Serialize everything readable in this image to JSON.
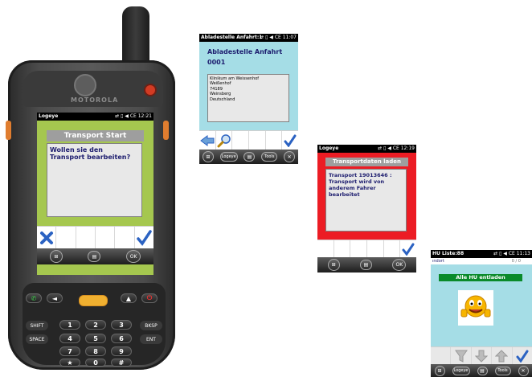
{
  "screen1": {
    "status_title": "Logeye",
    "status_icons": "⇄ ▯ ◀ CE 12:21",
    "panel_title": "Transport Start",
    "message": "Wollen sie den Transport bearbeiten?",
    "taskbar_ok": "OK",
    "colors": {
      "background": "#a5c74f",
      "panel": "#9e9e9e",
      "accent": "#2b62c2"
    }
  },
  "screen2": {
    "status_title": "Abladestelle Anfahrt:1",
    "status_icons": "⇄ ▯ ◀ CE 11:07",
    "heading": "Abladestelle Anfahrt",
    "number": "0001",
    "address_lines": [
      "Klinikum am Weissenhof",
      "Weißenhof",
      "74189",
      "Weinsberg",
      "Deutschland"
    ],
    "taskbar_logeye": "Logeye",
    "taskbar_tools": "Tools",
    "colors": {
      "background": "#a5dde6",
      "accent": "#2b62c2"
    }
  },
  "screen3": {
    "status_title": "Logeye",
    "status_icons": "⇄ ▯ ◀ CE 12:19",
    "panel_title": "Transportdaten laden",
    "message": "Transport 19013646 : Transport wird von anderem Fahrer bearbeitet",
    "taskbar_ok": "OK",
    "colors": {
      "background": "#ec1c24",
      "panel": "#9e9e9e"
    }
  },
  "screen4": {
    "status_title": "HU Liste:88",
    "status_icons": "⇄ ▯ ◀ CE 11:13",
    "row_label": "ındort",
    "counter": "0 / 0",
    "banner": "Alle HU entladen",
    "taskbar_logeye": "Logeye",
    "taskbar_tools": "Tools",
    "colors": {
      "background": "#a5dde6",
      "banner": "#0a8a2a"
    }
  },
  "device": {
    "brand": "MOTOROLA",
    "keys": {
      "row1": [
        "✆",
        "◄",
        "▲",
        "▼",
        "⏻"
      ],
      "row2": [
        "SHIFT",
        "1",
        "2",
        "3",
        "BKSP"
      ],
      "row3": [
        "SPACE",
        "4",
        "5",
        "6",
        "ENT"
      ],
      "row4": [
        "☼",
        "7",
        "8",
        "9",
        "✱"
      ],
      "row5": [
        "★",
        "0",
        "#"
      ]
    }
  }
}
